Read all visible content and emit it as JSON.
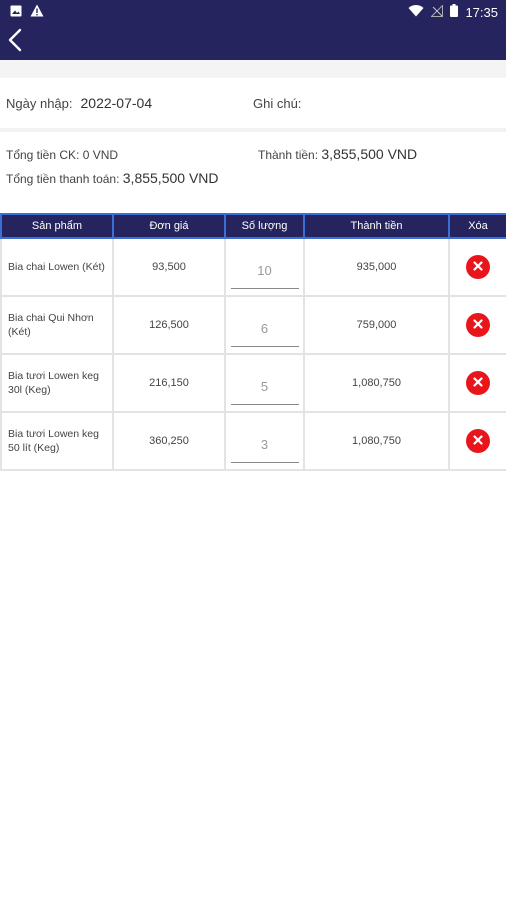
{
  "statusbar": {
    "time": "17:35"
  },
  "form": {
    "date_label": "Ngày nhập:",
    "date_value": "2022-07-04",
    "note_label": "Ghi chú:"
  },
  "totals": {
    "discount_label": "Tổng tiền CK:",
    "discount_value": "0 VND",
    "amount_label": "Thành tiền:",
    "amount_value": "3,855,500 VND",
    "payment_label": "Tổng tiền thanh toán:",
    "payment_value": "3,855,500 VND"
  },
  "table": {
    "headers": [
      "Sản phẩm",
      "Đơn giá",
      "Số lượng",
      "Thành tiền",
      "Xóa"
    ],
    "rows": [
      {
        "product": "Bia chai Lowen (Két)",
        "price": "93,500",
        "qty": "10",
        "total": "935,000"
      },
      {
        "product": "Bia chai Qui Nhơn (Két)",
        "price": "126,500",
        "qty": "6",
        "total": "759,000"
      },
      {
        "product": "Bia tươi Lowen keg 30l (Keg)",
        "price": "216,150",
        "qty": "5",
        "total": "1,080,750"
      },
      {
        "product": "Bia tươi Lowen keg 50 lít (Keg)",
        "price": "360,250",
        "qty": "3",
        "total": "1,080,750"
      }
    ]
  },
  "icons": {
    "back": "chevron-left-icon",
    "delete": "close-circle-icon"
  },
  "colors": {
    "primary": "#26245e",
    "header_border": "#3a6fd8",
    "delete": "#e8151b"
  }
}
